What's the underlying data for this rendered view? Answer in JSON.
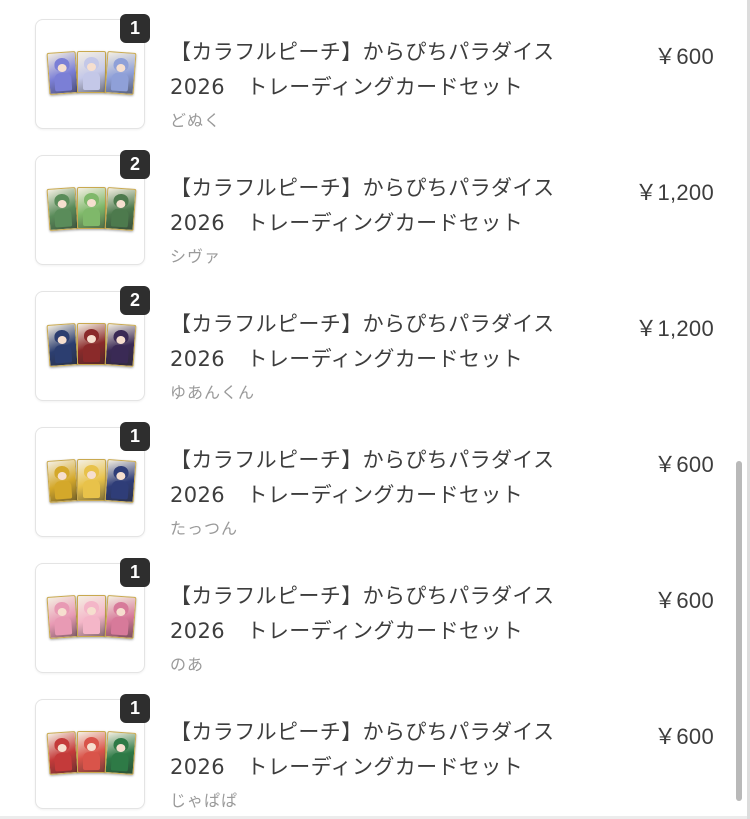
{
  "items": [
    {
      "qty": "1",
      "title": "【カラフルピーチ】からぴちパラダイス\n2026　トレーディングカードセット",
      "seller": "どぬく",
      "price": "￥600",
      "card_colors": [
        "#7b7fd6",
        "#c4c8e8",
        "#8fa0d8"
      ]
    },
    {
      "qty": "2",
      "title": "【カラフルピーチ】からぴちパラダイス\n2026　トレーディングカードセット",
      "seller": "シヴァ",
      "price": "￥1,200",
      "card_colors": [
        "#5a8c5a",
        "#7fb86a",
        "#4d7a4d"
      ]
    },
    {
      "qty": "2",
      "title": "【カラフルピーチ】からぴちパラダイス\n2026　トレーディングカードセット",
      "seller": "ゆあんくん",
      "price": "￥1,200",
      "card_colors": [
        "#2c3e70",
        "#8a2a2a",
        "#3a2a55"
      ]
    },
    {
      "qty": "1",
      "title": "【カラフルピーチ】からぴちパラダイス\n2026　トレーディングカードセット",
      "seller": "たっつん",
      "price": "￥600",
      "card_colors": [
        "#d4a82a",
        "#e8c24a",
        "#2f3d78"
      ]
    },
    {
      "qty": "1",
      "title": "【カラフルピーチ】からぴちパラダイス\n2026　トレーディングカードセット",
      "seller": "のあ",
      "price": "￥600",
      "card_colors": [
        "#e89ab4",
        "#f4b6c8",
        "#d77a9a"
      ]
    },
    {
      "qty": "1",
      "title": "【カラフルピーチ】からぴちパラダイス\n2026　トレーディングカードセット",
      "seller": "じゃぱぱ",
      "price": "￥600",
      "card_colors": [
        "#c43a3a",
        "#d9544a",
        "#2e7a46"
      ]
    }
  ]
}
